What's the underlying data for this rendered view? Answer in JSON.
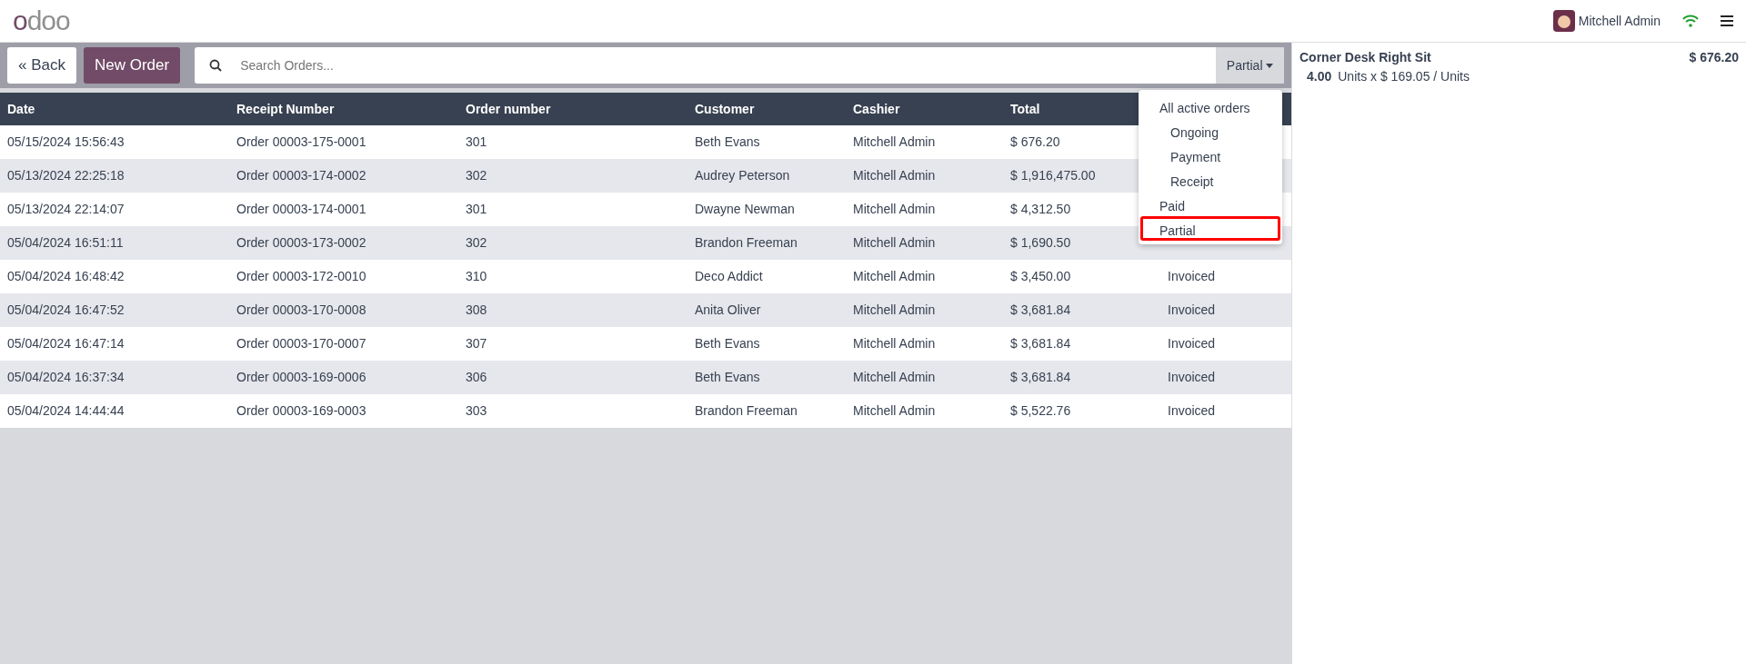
{
  "header": {
    "logo": "odoo",
    "user": "Mitchell Admin"
  },
  "toolbar": {
    "back": "Back",
    "back_icon": "«",
    "new_order": "New Order",
    "search": {
      "placeholder": "Search Orders..."
    },
    "filter": "Partial"
  },
  "table": {
    "columns": [
      "Date",
      "Receipt Number",
      "Order number",
      "Customer",
      "Cashier",
      "Total"
    ],
    "rows": [
      {
        "cells": [
          "05/15/2024 15:56:43",
          "Order 00003-175-0001",
          "301",
          "Beth Evans",
          "Mitchell Admin",
          "$ 676.20"
        ]
      },
      {
        "cells": [
          "05/13/2024 22:25:18",
          "Order 00003-174-0002",
          "302",
          "Audrey Peterson",
          "Mitchell Admin",
          "$ 1,916,475.00"
        ]
      },
      {
        "cells": [
          "05/13/2024 22:14:07",
          "Order 00003-174-0001",
          "301",
          "Dwayne Newman",
          "Mitchell Admin",
          "$ 4,312.50"
        ]
      },
      {
        "cells": [
          "05/04/2024 16:51:11",
          "Order 00003-173-0002",
          "302",
          "Brandon Freeman",
          "Mitchell Admin",
          "$ 1,690.50"
        ]
      },
      {
        "cells": [
          "05/04/2024 16:48:42",
          "Order 00003-172-0010",
          "310",
          "Deco Addict",
          "Mitchell Admin",
          "$ 3,450.00",
          "Invoiced"
        ]
      },
      {
        "cells": [
          "05/04/2024 16:47:52",
          "Order 00003-170-0008",
          "308",
          "Anita Oliver",
          "Mitchell Admin",
          "$ 3,681.84",
          "Invoiced"
        ]
      },
      {
        "cells": [
          "05/04/2024 16:47:14",
          "Order 00003-170-0007",
          "307",
          "Beth Evans",
          "Mitchell Admin",
          "$ 3,681.84",
          "Invoiced"
        ]
      },
      {
        "cells": [
          "05/04/2024 16:37:34",
          "Order 00003-169-0006",
          "306",
          "Beth Evans",
          "Mitchell Admin",
          "$ 3,681.84",
          "Invoiced"
        ]
      },
      {
        "cells": [
          "05/04/2024 14:44:44",
          "Order 00003-169-0003",
          "303",
          "Brandon Freeman",
          "Mitchell Admin",
          "$ 5,522.76",
          "Invoiced"
        ]
      }
    ]
  },
  "filter_menu": {
    "items": [
      {
        "label": "All active orders",
        "selected": false,
        "children": [
          {
            "label": "Ongoing",
            "selected": false
          },
          {
            "label": "Payment",
            "selected": false
          },
          {
            "label": "Receipt",
            "selected": false
          }
        ]
      },
      {
        "label": "Paid",
        "selected": false
      },
      {
        "label": "Partial",
        "selected": true
      }
    ]
  },
  "order_lines": [
    {
      "product": "Corner Desk Right Sit",
      "price": "$ 676.20",
      "quantity": "4.00",
      "detail": "Units x $ 169.05 / Units"
    }
  ]
}
